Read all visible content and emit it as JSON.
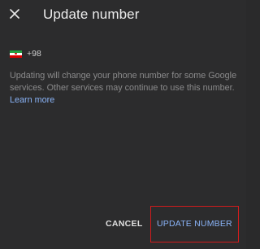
{
  "dialog": {
    "title": "Update number",
    "close_icon": "close-icon"
  },
  "phone": {
    "flag_icon": "iran-flag-icon",
    "country_code": "+98"
  },
  "description": {
    "text": "Updating will change your phone number for some Google services. Other services may continue to use this number. ",
    "link_label": "Learn more"
  },
  "actions": {
    "cancel_label": "CANCEL",
    "update_label": "UPDATE NUMBER"
  },
  "colors": {
    "background": "#2c2c2d",
    "accent": "#8ab4f8",
    "highlight": "#d11c1c"
  }
}
